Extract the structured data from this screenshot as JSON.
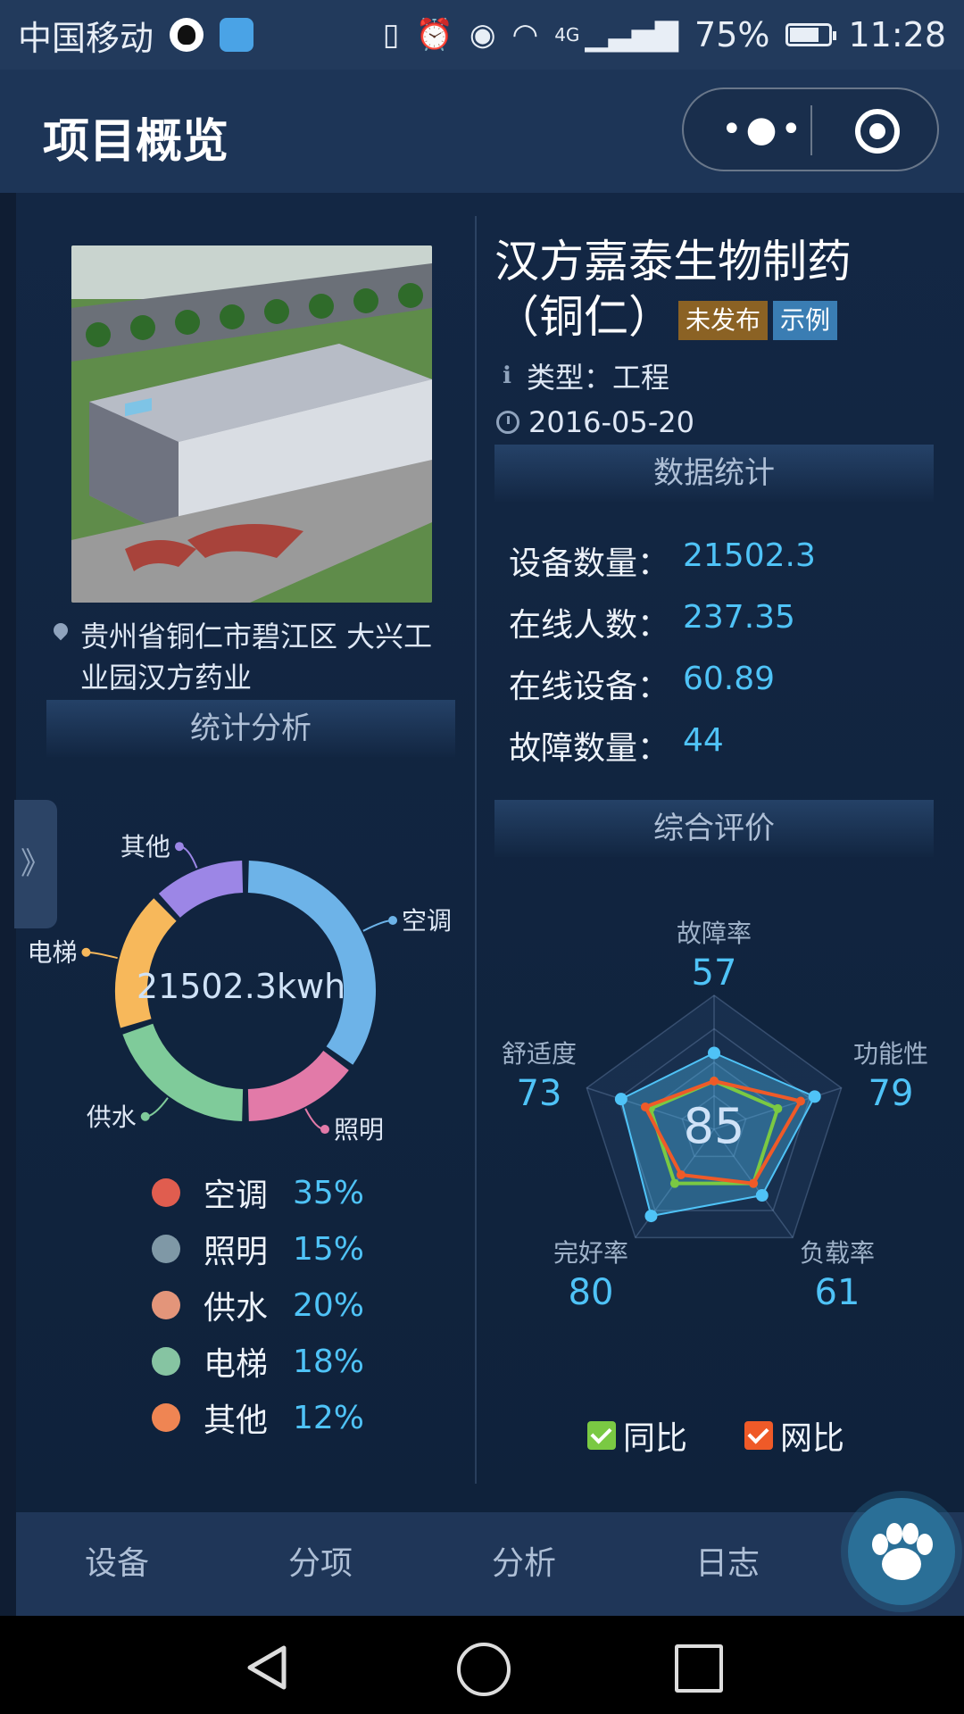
{
  "status_bar": {
    "carrier": "中国移动",
    "network": "4G",
    "battery": "75%",
    "battery_level": 0.75,
    "time": "11:28"
  },
  "header": {
    "title": "项目概览"
  },
  "project": {
    "name_line1": "汉方嘉泰生物制药",
    "name_line2": "（铜仁）",
    "tag_unpublished": "未发布",
    "tag_sample": "示例",
    "type": "类型：工程",
    "date": "2016-05-20",
    "address": "贵州省铜仁市碧江区 大兴工业园汉方药业"
  },
  "data_stats": {
    "title": "数据统计",
    "rows": [
      {
        "label": "设备数量：",
        "value": "21502.3"
      },
      {
        "label": "在线人数：",
        "value": "237.35"
      },
      {
        "label": "在线设备：",
        "value": "60.89"
      },
      {
        "label": "故障数量：",
        "value": "44"
      }
    ]
  },
  "analysis": {
    "title": "统计分析",
    "center_text": "21502.3kwh",
    "slice_labels": [
      "空调",
      "照明",
      "供水",
      "电梯",
      "其他"
    ],
    "legend": [
      {
        "name": "空调",
        "pct": "35%",
        "color": "#e05d4f"
      },
      {
        "name": "照明",
        "pct": "15%",
        "color": "#7f98a6"
      },
      {
        "name": "供水",
        "pct": "20%",
        "color": "#e3957a"
      },
      {
        "name": "电梯",
        "pct": "18%",
        "color": "#86c4a2"
      },
      {
        "name": "其他",
        "pct": "12%",
        "color": "#ef8553"
      }
    ]
  },
  "evaluation": {
    "title": "综合评价",
    "center_score": "85",
    "legend": [
      {
        "name": "同比",
        "color": "#7ac943"
      },
      {
        "name": "网比",
        "color": "#ef5a28"
      }
    ]
  },
  "chart_data": [
    {
      "type": "pie",
      "categories": [
        "空调",
        "照明",
        "供水",
        "电梯",
        "其他"
      ],
      "values": [
        35,
        15,
        20,
        18,
        12
      ],
      "colors": [
        "#6db3e8",
        "#e27aa8",
        "#7fcb9a",
        "#f7b85b",
        "#9c86e6"
      ],
      "center_label": "21502.3kwh"
    },
    {
      "type": "radar",
      "axes": [
        "故障率",
        "功能性",
        "负载率",
        "完好率",
        "舒适度"
      ],
      "axis_values": [
        "57",
        "79",
        "61",
        "80",
        "73"
      ],
      "max": 100,
      "center_label": "85",
      "series": [
        {
          "name": "同比",
          "values": [
            36,
            50,
            50,
            50,
            50
          ],
          "color": "#7ac943"
        },
        {
          "name": "网比",
          "values": [
            36,
            68,
            50,
            42,
            54
          ],
          "color": "#ef5a28"
        },
        {
          "values": [
            57,
            79,
            61,
            80,
            73
          ],
          "color": "#4fc3f7"
        }
      ]
    }
  ],
  "tabbar": {
    "tabs": [
      "设备",
      "分项",
      "分析",
      "日志"
    ]
  }
}
